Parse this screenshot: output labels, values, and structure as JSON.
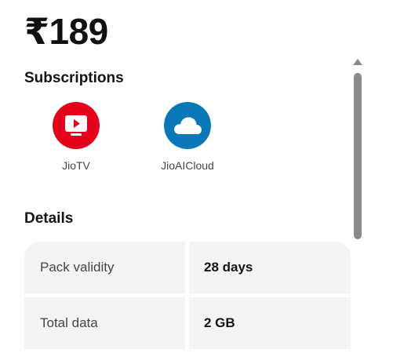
{
  "plan": {
    "price": "₹189"
  },
  "subscriptions": {
    "title": "Subscriptions",
    "items": [
      {
        "label": "JioTV",
        "icon": "tv-play-icon",
        "color": "#e3001b"
      },
      {
        "label": "JioAICloud",
        "icon": "cloud-icon",
        "color": "#0a77b9"
      }
    ]
  },
  "details": {
    "title": "Details",
    "rows": [
      {
        "label": "Pack validity",
        "value": "28 days"
      },
      {
        "label": "Total data",
        "value": "2 GB"
      }
    ]
  },
  "colors": {
    "text": "#141414",
    "muted": "#444444",
    "cell_background": "#f4f4f4",
    "scrollbar": "#8a8a8a"
  }
}
